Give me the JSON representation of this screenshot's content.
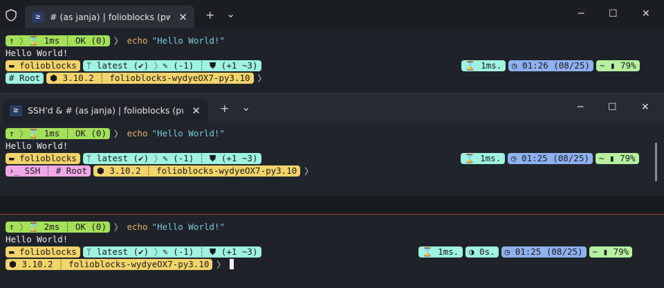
{
  "win1": {
    "tab_title": "# (as janja) | folioblocks (pwsh)",
    "prompt": {
      "arrow_up": "↑",
      "duration": "⌛ 1ms",
      "status": "OK (0)"
    },
    "command": "echo",
    "command_arg": "\"Hello World!\"",
    "output": "Hello World!",
    "git": {
      "folder": "▬ folioblocks",
      "branch": "ᛘ latest (✔)",
      "edits": "✎ (-1)",
      "stash": "⛊ (+1 ~3)"
    },
    "env": {
      "root": "# Root",
      "python": "⬢ 3.10.2",
      "venv": "folioblocks-wydyeOX7-py3.10"
    },
    "right": {
      "time": "⌛ 1ms.",
      "clock": "◷ 01:26 (08/25)",
      "battery": "~ ▮ 79%"
    }
  },
  "win2": {
    "tab_title": "SSH'd & # (as janja) | folioblocks (pwsh)",
    "prompt": {
      "arrow_up": "↑",
      "duration": "⌛ 1ms",
      "status": "OK (0)"
    },
    "command": "echo",
    "command_arg": "\"Hello World!\"",
    "output": "Hello World!",
    "git": {
      "folder": "▬ folioblocks",
      "branch": "ᛘ latest (✔)",
      "edits": "✎ (-1)",
      "stash": "⛊ (+1 ~3)"
    },
    "env": {
      "ssh": "›_ SSH",
      "root": "# Root",
      "python": "⬢ 3.10.2",
      "venv": "folioblocks-wydyeOX7-py3.10"
    },
    "right": {
      "time": "⌛ 1ms.",
      "clock": "◷ 01:25 (08/25)",
      "battery": "~ ▮ 79%"
    }
  },
  "win3": {
    "prompt": {
      "arrow_up": "↑",
      "duration": "⌛ 2ms",
      "status": "OK (0)"
    },
    "command": "echo",
    "command_arg": "\"Hello World!\"",
    "output": "Hello World!",
    "git": {
      "folder": "▬ folioblocks",
      "branch": "ᛘ latest (✔)",
      "edits": "✎ (-1)",
      "stash": "⛊ (+1 ~3)"
    },
    "env": {
      "python": "⬢ 3.10.2",
      "venv": "folioblocks-wydyeOX7-py3.10"
    },
    "right": {
      "time": "⌛ 1ms.",
      "cpu": "◑ 0s.",
      "clock": "◷ 01:25 (08/25)",
      "battery": "~ ▮ 79%"
    }
  },
  "titlebar": {
    "new_tab": "+",
    "dropdown": "⌄",
    "minimize": "─",
    "maximize": "☐",
    "close": "✕",
    "tab_close": "✕",
    "ps_icon": "≥"
  },
  "colors": {
    "green": "#a4e05a",
    "teal": "#9ff3e0",
    "yellow": "#f2d46b",
    "blue": "#8fb1f0",
    "pink": "#f0a8e6"
  }
}
